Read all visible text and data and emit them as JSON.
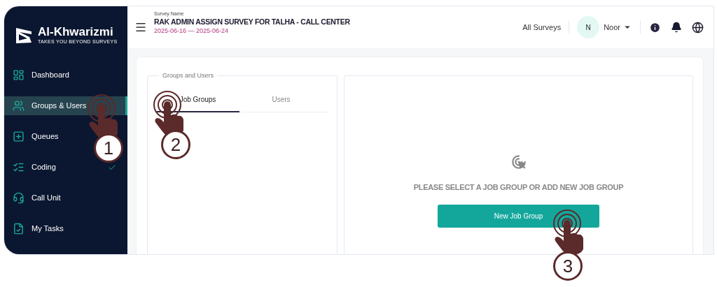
{
  "brand": {
    "name": "Al-Khwarizmi",
    "tagline": "TAKES YOU BEYOND SURVEYS"
  },
  "sidebar": {
    "items": [
      {
        "label": "Dashboard",
        "kind": "dashboard",
        "selected": false,
        "done": false
      },
      {
        "label": "Groups & Users",
        "kind": "users",
        "selected": true,
        "done": false
      },
      {
        "label": "Queues",
        "kind": "queues",
        "selected": false,
        "done": false
      },
      {
        "label": "Coding",
        "kind": "coding",
        "selected": false,
        "done": true
      },
      {
        "label": "Call Unit",
        "kind": "headset",
        "selected": false,
        "done": false
      },
      {
        "label": "My Tasks",
        "kind": "tasks",
        "selected": false,
        "done": false
      }
    ]
  },
  "header": {
    "survey_label": "Survey Name",
    "survey_title": "RAK ADMIN ASSIGN SURVEY FOR TALHA - CALL CENTER",
    "dates": "2025-06-16 — 2025-06-24",
    "all_surveys": "All Surveys",
    "avatar_initial": "N",
    "user_name": "Noor"
  },
  "groups_panel": {
    "legend": "Groups and Users",
    "tabs": [
      {
        "label": "Job Groups",
        "selected": true
      },
      {
        "label": "Users",
        "selected": false
      }
    ]
  },
  "detail_panel": {
    "message": "PLEASE SELECT A JOB GROUP OR ADD NEW JOB GROUP",
    "button": "New Job Group"
  },
  "annotations": [
    {
      "step": "1"
    },
    {
      "step": "2"
    },
    {
      "step": "3"
    }
  ]
}
